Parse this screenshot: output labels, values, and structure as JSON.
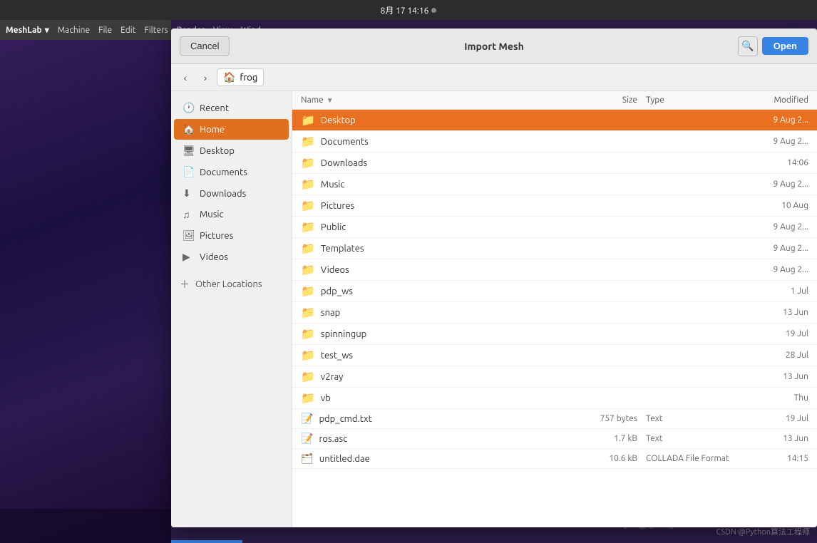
{
  "topbar": {
    "datetime": "8月 17  14:16",
    "dot": true
  },
  "menubar": {
    "app_name": "MeshLab",
    "menu_items": [
      "Machine",
      "File",
      "Edit",
      "Filters",
      "Render",
      "View",
      "Wind..."
    ]
  },
  "dialog": {
    "title": "Import Mesh",
    "cancel_label": "Cancel",
    "open_label": "Open"
  },
  "nav": {
    "breadcrumb": "frog",
    "back_arrow": "‹",
    "forward_arrow": "›"
  },
  "sidebar": {
    "items": [
      {
        "id": "recent",
        "label": "Recent",
        "icon": "🕐",
        "active": false
      },
      {
        "id": "home",
        "label": "Home",
        "icon": "🏠",
        "active": true
      },
      {
        "id": "desktop",
        "label": "Desktop",
        "icon": "🖥",
        "active": false
      },
      {
        "id": "documents",
        "label": "Documents",
        "icon": "📄",
        "active": false
      },
      {
        "id": "downloads",
        "label": "Downloads",
        "icon": "⬇",
        "active": false
      },
      {
        "id": "music",
        "label": "Music",
        "icon": "♫",
        "active": false
      },
      {
        "id": "pictures",
        "label": "Pictures",
        "icon": "🖼",
        "active": false
      },
      {
        "id": "videos",
        "label": "Videos",
        "icon": "▶",
        "active": false
      }
    ],
    "other_locations_label": "Other Locations",
    "add_icon": "+"
  },
  "file_list": {
    "columns": {
      "name": "Name",
      "size": "Size",
      "type": "Type",
      "modified": "Modified"
    },
    "files": [
      {
        "name": "Desktop",
        "type": "folder",
        "size": "",
        "file_type": "",
        "modified": "9 Aug 2...",
        "selected": true
      },
      {
        "name": "Documents",
        "type": "folder",
        "size": "",
        "file_type": "",
        "modified": "9 Aug 2...",
        "selected": false
      },
      {
        "name": "Downloads",
        "type": "folder",
        "size": "",
        "file_type": "",
        "modified": "14:06",
        "selected": false
      },
      {
        "name": "Music",
        "type": "folder",
        "size": "",
        "file_type": "",
        "modified": "9 Aug 2...",
        "selected": false
      },
      {
        "name": "Pictures",
        "type": "folder",
        "size": "",
        "file_type": "",
        "modified": "10 Aug",
        "selected": false
      },
      {
        "name": "Public",
        "type": "folder",
        "size": "",
        "file_type": "",
        "modified": "9 Aug 2...",
        "selected": false
      },
      {
        "name": "Templates",
        "type": "folder",
        "size": "",
        "file_type": "",
        "modified": "9 Aug 2...",
        "selected": false
      },
      {
        "name": "Videos",
        "type": "folder",
        "size": "",
        "file_type": "",
        "modified": "9 Aug 2...",
        "selected": false
      },
      {
        "name": "pdp_ws",
        "type": "folder",
        "size": "",
        "file_type": "",
        "modified": "1 Jul",
        "selected": false
      },
      {
        "name": "snap",
        "type": "folder",
        "size": "",
        "file_type": "",
        "modified": "13 Jun",
        "selected": false
      },
      {
        "name": "spinningup",
        "type": "folder",
        "size": "",
        "file_type": "",
        "modified": "19 Jul",
        "selected": false
      },
      {
        "name": "test_ws",
        "type": "folder",
        "size": "",
        "file_type": "",
        "modified": "28 Jul",
        "selected": false
      },
      {
        "name": "v2ray",
        "type": "folder",
        "size": "",
        "file_type": "",
        "modified": "13 Jun",
        "selected": false
      },
      {
        "name": "vb",
        "type": "folder",
        "size": "",
        "file_type": "",
        "modified": "Thu",
        "selected": false
      },
      {
        "name": "pdp_cmd.txt",
        "type": "text",
        "size": "757 bytes",
        "file_type": "Text",
        "modified": "19 Jul",
        "selected": false
      },
      {
        "name": "ros.asc",
        "type": "text",
        "size": "1.7 kB",
        "file_type": "Text",
        "modified": "13 Jun",
        "selected": false
      },
      {
        "name": "untitled.dae",
        "type": "dae",
        "size": "10.6 kB",
        "file_type": "COLLADA File Format",
        "modified": "14:15",
        "selected": false
      }
    ]
  },
  "watermark": "周义",
  "csdn_text": "CSDN @Python算法工程师"
}
